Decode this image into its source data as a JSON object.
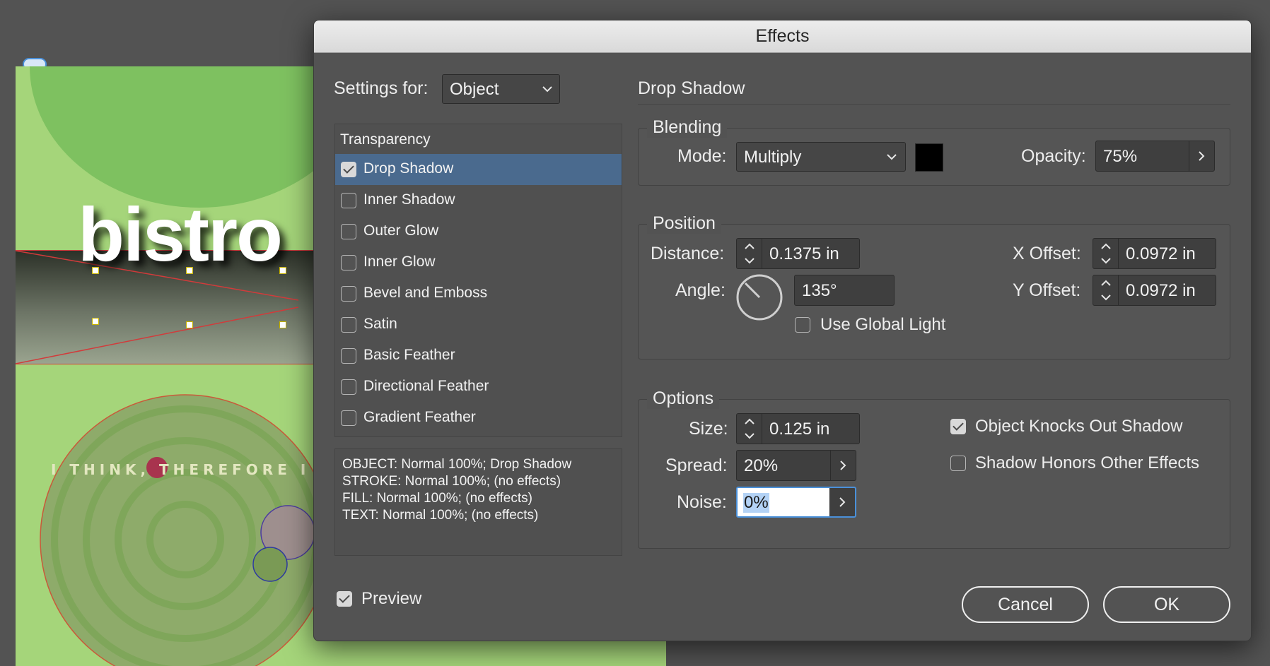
{
  "dialog": {
    "title": "Effects",
    "settings_for_label": "Settings for:",
    "settings_for_value": "Object",
    "section_title": "Drop Shadow",
    "effects_header": "Transparency",
    "effects": [
      {
        "label": "Drop Shadow",
        "checked": true,
        "selected": true
      },
      {
        "label": "Inner Shadow",
        "checked": false,
        "selected": false
      },
      {
        "label": "Outer Glow",
        "checked": false,
        "selected": false
      },
      {
        "label": "Inner Glow",
        "checked": false,
        "selected": false
      },
      {
        "label": "Bevel and Emboss",
        "checked": false,
        "selected": false
      },
      {
        "label": "Satin",
        "checked": false,
        "selected": false
      },
      {
        "label": "Basic Feather",
        "checked": false,
        "selected": false
      },
      {
        "label": "Directional Feather",
        "checked": false,
        "selected": false
      },
      {
        "label": "Gradient Feather",
        "checked": false,
        "selected": false
      }
    ],
    "summary": [
      "OBJECT: Normal 100%; Drop Shadow",
      "STROKE: Normal 100%; (no effects)",
      "FILL: Normal 100%; (no effects)",
      "TEXT: Normal 100%; (no effects)"
    ],
    "blending": {
      "title": "Blending",
      "mode_label": "Mode:",
      "mode_value": "Multiply",
      "swatch_color": "#000000",
      "opacity_label": "Opacity:",
      "opacity_value": "75%"
    },
    "position": {
      "title": "Position",
      "distance_label": "Distance:",
      "distance_value": "0.1375 in",
      "angle_label": "Angle:",
      "angle_value": "135°",
      "use_global_light_label": "Use Global Light",
      "use_global_light_checked": false,
      "x_offset_label": "X Offset:",
      "x_offset_value": "0.0972 in",
      "y_offset_label": "Y Offset:",
      "y_offset_value": "0.0972 in"
    },
    "options": {
      "title": "Options",
      "size_label": "Size:",
      "size_value": "0.125 in",
      "spread_label": "Spread:",
      "spread_value": "20%",
      "noise_label": "Noise:",
      "noise_value": "0%",
      "knocks_out_label": "Object Knocks Out Shadow",
      "knocks_out_checked": true,
      "honors_label": "Shadow Honors Other Effects",
      "honors_checked": false
    },
    "preview_label": "Preview",
    "preview_checked": true,
    "cancel_label": "Cancel",
    "ok_label": "OK"
  },
  "document": {
    "headline": "bistro",
    "tagline": "I THINK, THEREFORE I DINE.",
    "colors": {
      "page_green": "#a5d57a",
      "selection_blue": "#4a6a8e"
    }
  }
}
